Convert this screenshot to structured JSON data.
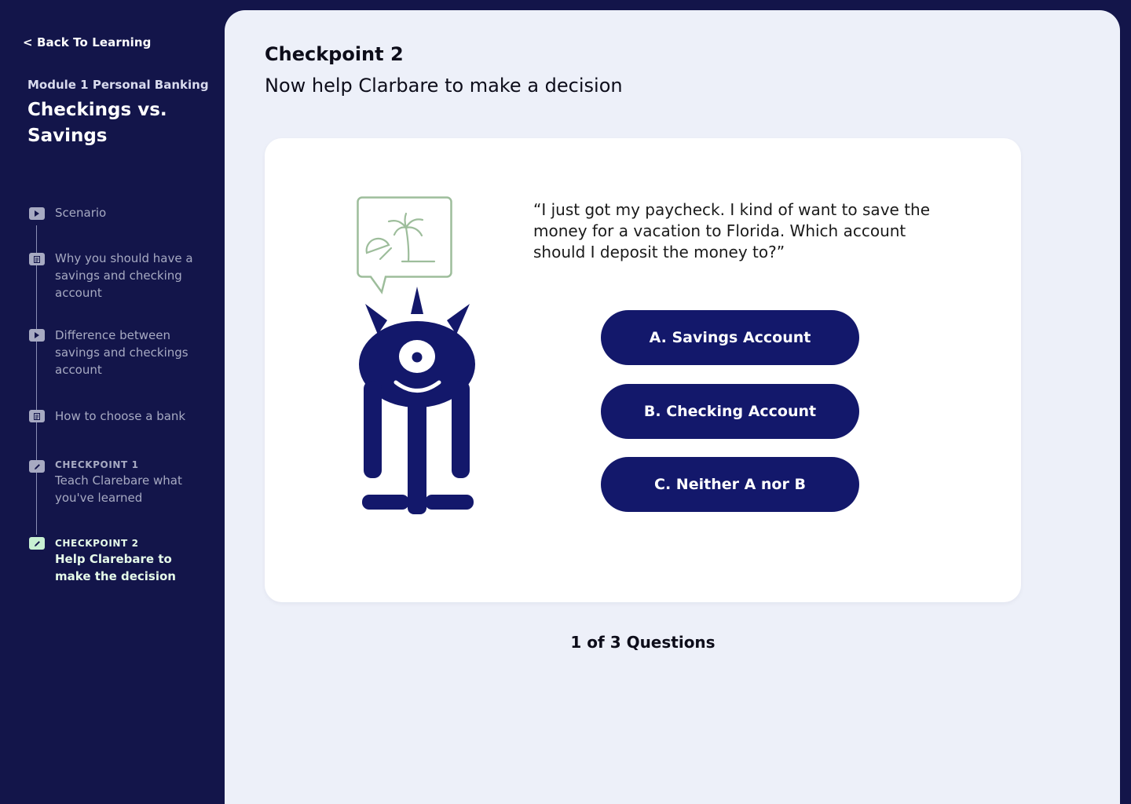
{
  "sidebar": {
    "back_label": "< Back To Learning",
    "module_label": "Module 1 Personal Banking",
    "module_title": "Checkings vs. Savings",
    "steps": [
      {
        "icon": "play-icon",
        "kicker": "",
        "label": "Scenario",
        "active": false
      },
      {
        "icon": "reading-icon",
        "kicker": "",
        "label": "Why you should have a savings and checking account",
        "active": false
      },
      {
        "icon": "play-icon",
        "kicker": "",
        "label": "Difference between savings and checkings account",
        "active": false
      },
      {
        "icon": "reading-icon",
        "kicker": "",
        "label": "How to choose a bank",
        "active": false
      },
      {
        "icon": "pencil-icon",
        "kicker": "CHECKPOINT 1",
        "label": "Teach Clarebare what you've learned",
        "active": false
      },
      {
        "icon": "pencil-icon",
        "kicker": "CHECKPOINT 2",
        "label": "Help Clarebare to make the decision",
        "active": true
      }
    ]
  },
  "main": {
    "title": "Checkpoint 2",
    "subtitle": "Now help Clarbare to make a decision",
    "question": {
      "quote": "“I just got my paycheck. I kind of want to save the money for a vacation to Florida. Which account should I deposit the money to?”",
      "thought_bubble_icon": "palm-tree-beach-icon",
      "character": "one-eyed-monster"
    },
    "answers": [
      {
        "label": "A. Savings Account"
      },
      {
        "label": "B. Checking Account"
      },
      {
        "label": "C. Neither A nor B"
      }
    ],
    "progress": "1 of 3 Questions"
  },
  "colors": {
    "sidebar_bg": "#13154a",
    "panel_bg": "#edf0f9",
    "button_bg": "#13186b",
    "character": "#13186b",
    "bubble_green": "#9dbd9b",
    "active_step": "#c8f0d2"
  }
}
